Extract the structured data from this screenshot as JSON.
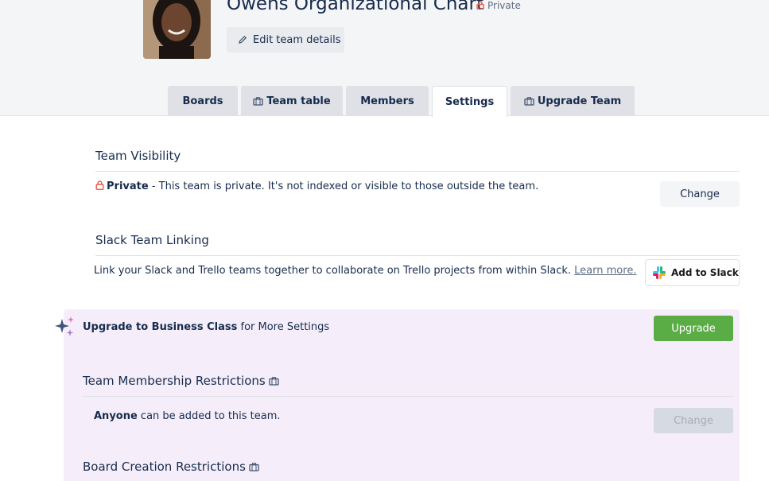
{
  "header": {
    "team_name": "Owens Organizational Chart",
    "visibility_tag": "Private",
    "edit_button": "Edit team details"
  },
  "tabs": [
    {
      "label": "Boards",
      "icon": null
    },
    {
      "label": "Team table",
      "icon": "briefcase-icon"
    },
    {
      "label": "Members",
      "icon": null
    },
    {
      "label": "Settings",
      "icon": null,
      "active": true
    },
    {
      "label": "Upgrade Team",
      "icon": "briefcase-icon"
    }
  ],
  "visibility": {
    "title": "Team Visibility",
    "status": "Private",
    "description": " - This team is private. It's not indexed or visible to those outside the team.",
    "change_button": "Change"
  },
  "slack": {
    "title": "Slack Team Linking",
    "description": "Link your Slack and Trello teams together to collaborate on Trello projects from within Slack. ",
    "learn_more": "Learn more.",
    "button": "Add to Slack"
  },
  "upsell": {
    "headline_bold": "Upgrade to Business Class",
    "headline_rest": " for More Settings",
    "upgrade_button": "Upgrade"
  },
  "membership": {
    "title": "Team Membership Restrictions",
    "who": "Anyone",
    "rest": " can be added to this team.",
    "change_button": "Change"
  },
  "board_creation": {
    "title": "Board Creation Restrictions"
  },
  "colors": {
    "upgrade_green": "#5aac44",
    "upsell_bg": "#f5eefa",
    "private_red": "#eb5a46"
  }
}
